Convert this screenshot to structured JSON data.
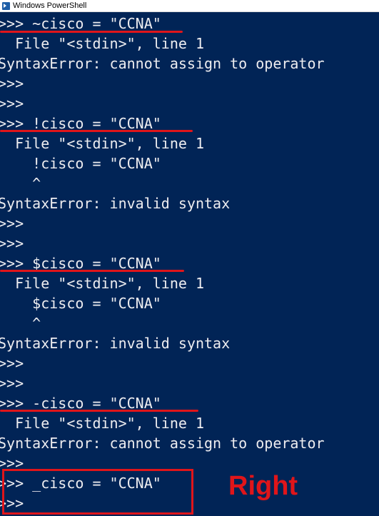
{
  "window": {
    "title": "Windows PowerShell",
    "icon": "powershell-icon"
  },
  "colors": {
    "background": "#012456",
    "text": "#eeedf0",
    "annotation": "#e0151a"
  },
  "console_lines": [
    ">>> ~cisco = \"CCNA\"",
    "  File \"<stdin>\", line 1",
    "SyntaxError: cannot assign to operator",
    ">>>",
    ">>>",
    ">>> !cisco = \"CCNA\"",
    "  File \"<stdin>\", line 1",
    "    !cisco = \"CCNA\"",
    "    ^",
    "SyntaxError: invalid syntax",
    ">>>",
    ">>>",
    ">>> $cisco = \"CCNA\"",
    "  File \"<stdin>\", line 1",
    "    $cisco = \"CCNA\"",
    "    ^",
    "SyntaxError: invalid syntax",
    ">>>",
    ">>>",
    ">>> -cisco = \"CCNA\"",
    "  File \"<stdin>\", line 1",
    "SyntaxError: cannot assign to operator",
    ">>>",
    ">>> _cisco = \"CCNA\"",
    ">>>"
  ],
  "annotation": {
    "label": "Right"
  }
}
